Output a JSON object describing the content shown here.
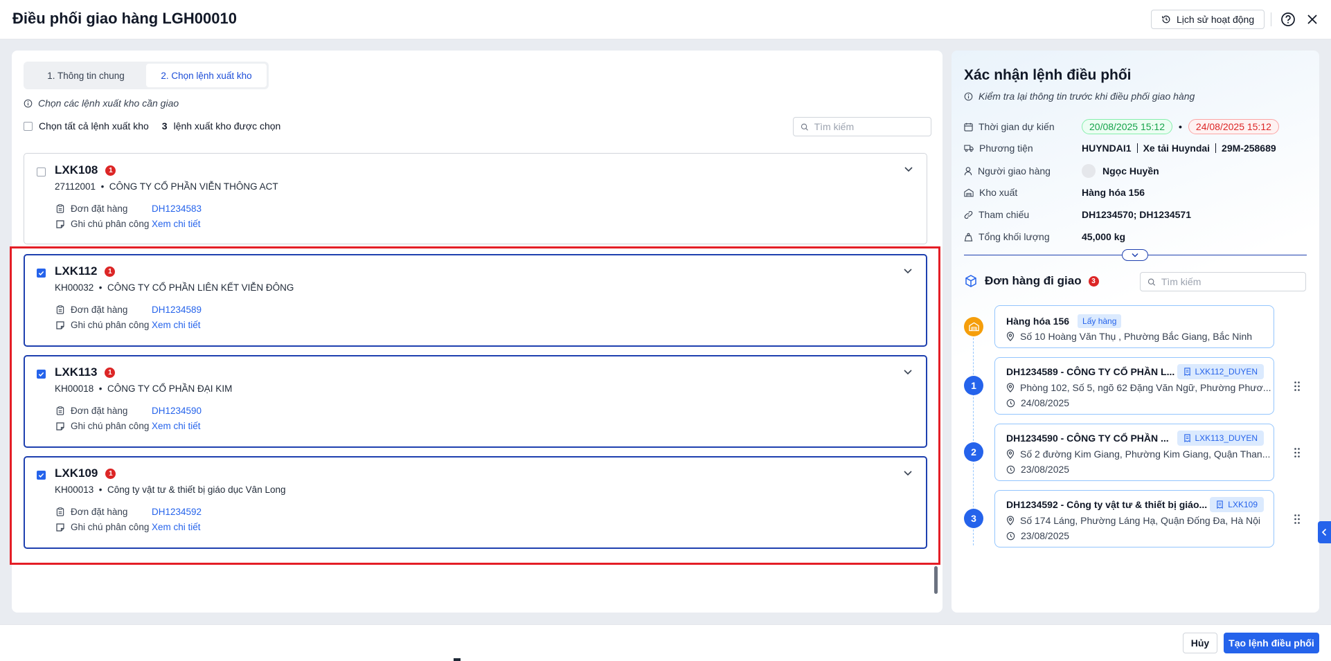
{
  "header": {
    "title": "Điều phối giao hàng LGH00010",
    "history_label": "Lịch sử hoạt động"
  },
  "tabs": [
    {
      "label": "1. Thông tin chung",
      "active": false
    },
    {
      "label": "2. Chọn lệnh xuất kho",
      "active": true
    }
  ],
  "left": {
    "hint": "Chọn các lệnh xuất kho cần giao",
    "select_all_label": "Chọn tất cả lệnh xuất kho",
    "selected_count": "3",
    "selected_suffix": "lệnh xuất kho được chọn",
    "search_placeholder": "Tìm kiếm",
    "order_label": "Đơn đặt hàng",
    "note_label": "Ghi chú phân công",
    "note_link": "Xem chi tiết",
    "cards": [
      {
        "code": "LXK108",
        "badge": "1",
        "checked": false,
        "customer_code": "27112001",
        "customer_name": "CÔNG TY CỔ PHẦN VIỄN THÔNG ACT",
        "order": "DH1234583"
      },
      {
        "code": "LXK112",
        "badge": "1",
        "checked": true,
        "customer_code": "KH00032",
        "customer_name": "CÔNG TY CỔ PHẦN LIÊN KẾT VIỄN ĐÔNG",
        "order": "DH1234589"
      },
      {
        "code": "LXK113",
        "badge": "1",
        "checked": true,
        "customer_code": "KH00018",
        "customer_name": "CÔNG TY CỔ PHẦN ĐẠI KIM",
        "order": "DH1234590"
      },
      {
        "code": "LXK109",
        "badge": "1",
        "checked": true,
        "customer_code": "KH00013",
        "customer_name": "Công ty vật tư & thiết bị giáo dục Vân Long",
        "order": "DH1234592"
      }
    ]
  },
  "right": {
    "title": "Xác nhận lệnh điều phối",
    "hint": "Kiểm tra lại thông tin trước khi điều phối giao hàng",
    "labels": {
      "time": "Thời gian dự kiến",
      "vehicle": "Phương tiện",
      "driver": "Người giao hàng",
      "warehouse": "Kho xuất",
      "reference": "Tham chiếu",
      "weight": "Tổng khối lượng"
    },
    "time_start": "20/08/2025 15:12",
    "time_end": "24/08/2025 15:12",
    "vehicle_code": "HUYNDAI1",
    "vehicle_name": "Xe tải Huyndai",
    "vehicle_plate": "29M-258689",
    "driver_name": "Ngọc Huyền",
    "warehouse": "Hàng hóa 156",
    "reference": "DH1234570; DH1234571",
    "weight": "45,000 kg",
    "orders_title": "Đơn hàng đi giao",
    "orders_count": "3",
    "search_placeholder": "Tìm kiếm",
    "pickup": {
      "name": "Hàng hóa 156",
      "tag": "Lấy hàng",
      "address": "Số 10 Hoàng Văn Thụ , Phường Bắc Giang, Bắc Ninh"
    },
    "stops": [
      {
        "num": "1",
        "title": "DH1234589 - CÔNG TY CỔ PHẦN L...",
        "tag": "LXK112_DUYEN",
        "address": "Phòng 102, Số 5, ngõ 62 Đặng Văn Ngữ, Phường Phươ...",
        "date": "24/08/2025"
      },
      {
        "num": "2",
        "title": "DH1234590 - CÔNG TY CỔ PHẦN ...",
        "tag": "LXK113_DUYEN",
        "address": "Số 2 đường Kim Giang, Phường Kim Giang, Quận Than...",
        "date": "23/08/2025"
      },
      {
        "num": "3",
        "title": "DH1234592 - Công ty vật tư & thiết bị giáo...",
        "tag": "LXK109",
        "address": "Số 174 Láng, Phường Láng Hạ, Quận Đống Đa, Hà Nội",
        "date": "23/08/2025"
      }
    ]
  },
  "footer": {
    "cancel_label": "Hủy",
    "submit_label": "Tạo lệnh điều phối"
  },
  "colors": {
    "primary": "#2563eb",
    "highlight": "#e41e26",
    "badge": "#dc2626",
    "pickup": "#f59e0b"
  }
}
